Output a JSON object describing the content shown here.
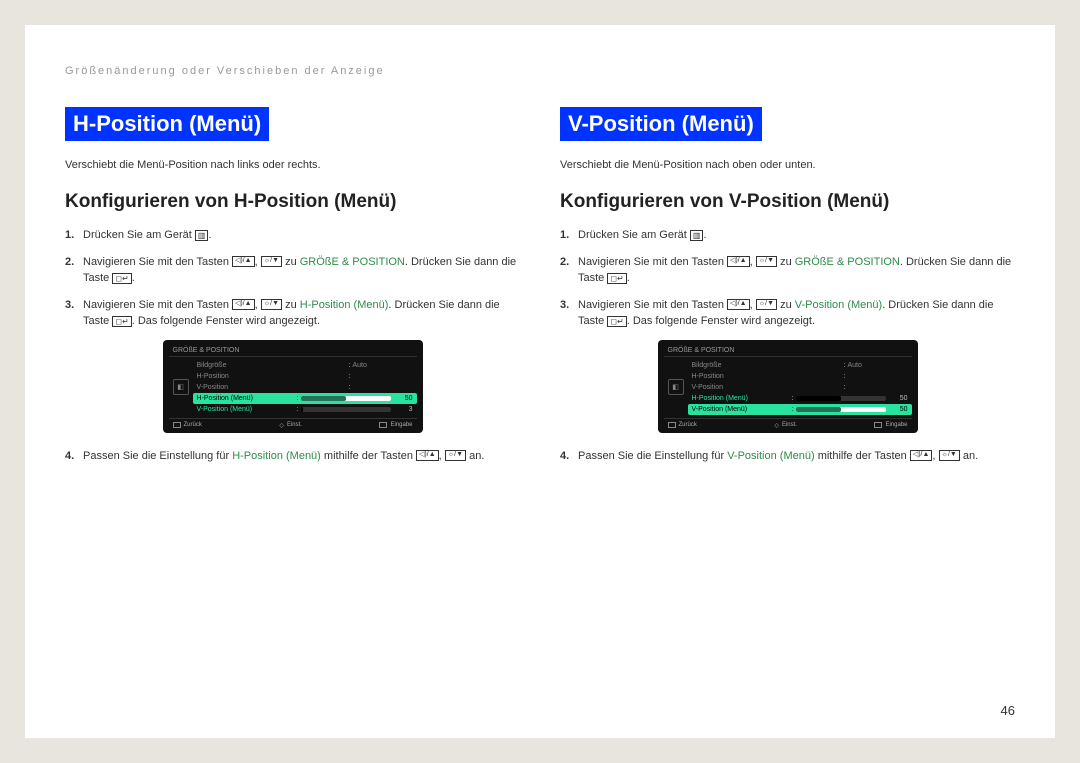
{
  "chapter": "Größenänderung oder Verschieben der Anzeige",
  "page_number": "46",
  "left": {
    "title": "H-Position (Menü)",
    "desc": "Verschiebt die Menü-Position nach links oder rechts.",
    "subtitle": "Konfigurieren von H-Position (Menü)",
    "step1": "Drücken Sie am Gerät ",
    "step2a": "Navigieren Sie mit den Tasten ",
    "step2b": " zu ",
    "step2_target": "GRÖßE & POSITION",
    "step2c": ". Drücken Sie dann die Taste ",
    "step3a": "Navigieren Sie mit den Tasten ",
    "step3b": " zu ",
    "step3_target": "H-Position (Menü)",
    "step3c": ". Drücken Sie dann die Taste ",
    "step3d": ". Das folgende Fenster wird angezeigt.",
    "step4a": "Passen Sie die Einstellung für ",
    "step4_target": "H-Position (Menü)",
    "step4b": " mithilfe der Tasten ",
    "step4c": " an.",
    "period": ".",
    "osd": {
      "title": "GRÖßE & POSITION",
      "rows": [
        {
          "label": "Bildgröße",
          "value": "Auto"
        },
        {
          "label": "H-Position",
          "value": ""
        },
        {
          "label": "V-Position",
          "value": ""
        },
        {
          "label": "H-Position (Menü)",
          "value": "50"
        },
        {
          "label": "V-Position (Menü)",
          "value": "3"
        }
      ],
      "highlight_index": 3,
      "footer": {
        "back": "Zurück",
        "adjust": "Einst.",
        "enter": "Eingabe"
      }
    }
  },
  "right": {
    "title": "V-Position (Menü)",
    "desc": "Verschiebt die Menü-Position nach oben oder unten.",
    "subtitle": "Konfigurieren von V-Position (Menü)",
    "step1": "Drücken Sie am Gerät ",
    "step2a": "Navigieren Sie mit den Tasten ",
    "step2b": " zu ",
    "step2_target": "GRÖßE & POSITION",
    "step2c": ". Drücken Sie dann die Taste ",
    "step3a": "Navigieren Sie mit den Tasten ",
    "step3b": " zu ",
    "step3_target": "V-Position (Menü)",
    "step3c": ". Drücken Sie dann die Taste ",
    "step3d": ".   Das folgende Fenster wird angezeigt.",
    "step4a": "Passen Sie die Einstellung für ",
    "step4_target": "V-Position (Menü)",
    "step4b": " mithilfe der Tasten ",
    "step4c": " an.",
    "period": ".",
    "osd": {
      "title": "GRÖßE & POSITION",
      "rows": [
        {
          "label": "Bildgröße",
          "value": "Auto"
        },
        {
          "label": "H-Position",
          "value": ""
        },
        {
          "label": "V-Position",
          "value": ""
        },
        {
          "label": "H-Position (Menü)",
          "value": "50"
        },
        {
          "label": "V-Position (Menü)",
          "value": "50"
        }
      ],
      "highlight_index": 4,
      "footer": {
        "back": "Zurück",
        "adjust": "Einst.",
        "enter": "Eingabe"
      }
    }
  }
}
